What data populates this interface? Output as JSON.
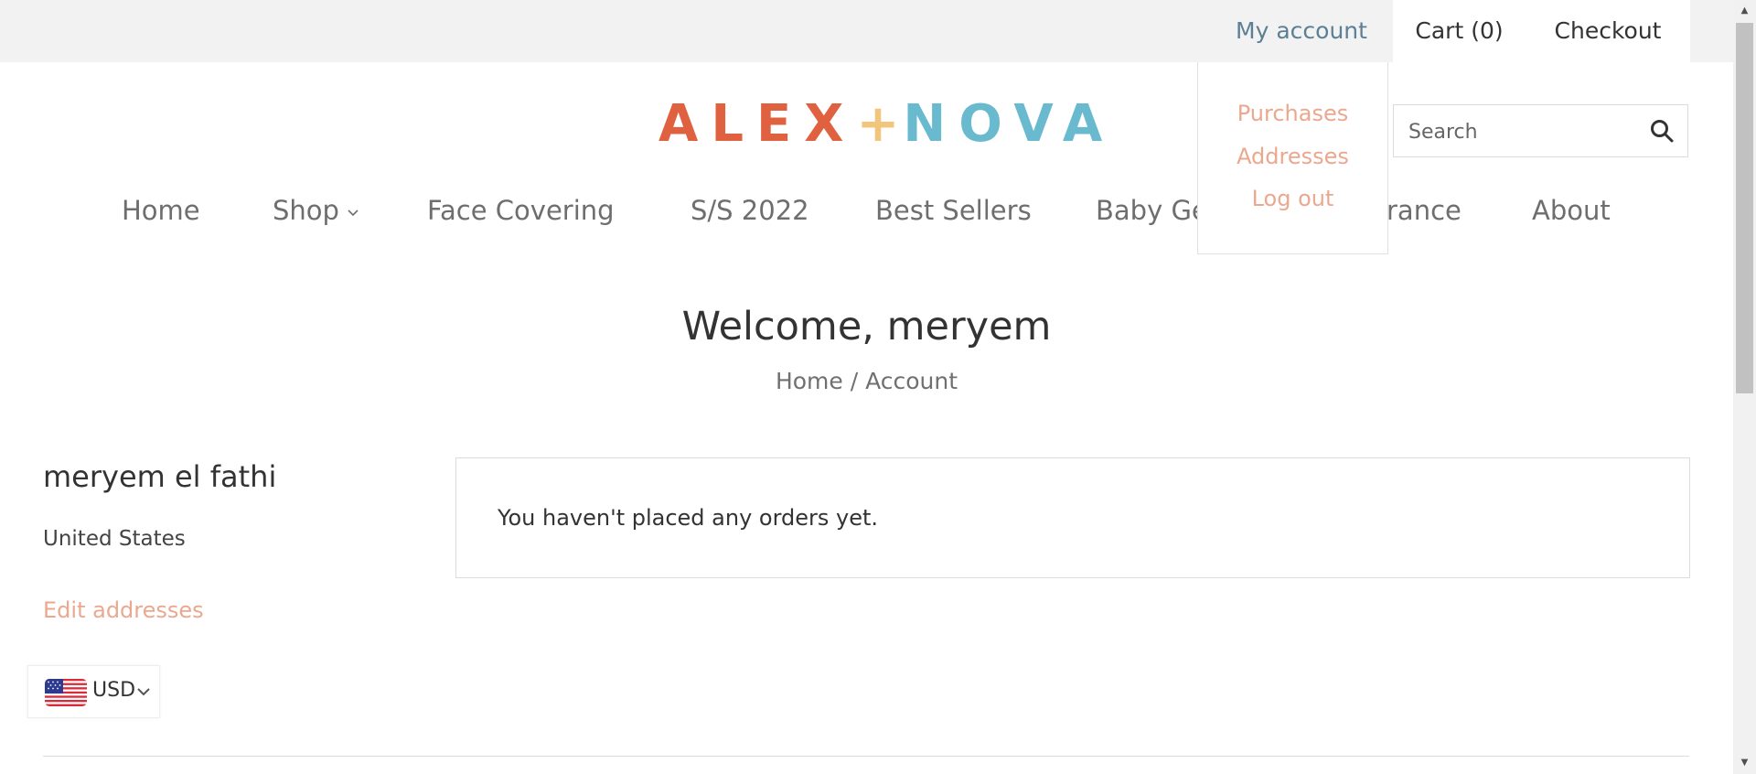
{
  "topbar": {
    "my_account": "My account",
    "cart": "Cart (0)",
    "checkout": "Checkout"
  },
  "account_menu": {
    "items": [
      "Purchases",
      "Addresses",
      "Log out"
    ]
  },
  "logo": {
    "left": "ALEX",
    "symbol": "+",
    "right": "NOVA",
    "colors": {
      "alex": "#e0613f",
      "plus": "#f3c57c",
      "nova": "#69b9cf"
    }
  },
  "search": {
    "placeholder": "Search",
    "icon": "search-icon"
  },
  "nav": {
    "items": [
      "Home",
      "Shop",
      "Face Covering",
      "S/S 2022",
      "Best Sellers",
      "Baby Ge",
      "rance",
      "About"
    ]
  },
  "page": {
    "title": "Welcome, meryem",
    "breadcrumb": {
      "home": "Home",
      "separator": "/",
      "current": "Account"
    }
  },
  "customer": {
    "name": "meryem el fathi",
    "country": "United States",
    "edit_addresses": "Edit addresses"
  },
  "orders": {
    "empty_message": "You haven't placed any orders yet."
  },
  "currency": {
    "code": "USD",
    "flag": "us-flag-icon"
  },
  "colors": {
    "accent_link": "#eba88f",
    "account_link": "#5b7f95",
    "topbar_bg": "#f2f2f2",
    "text": "#333333"
  }
}
